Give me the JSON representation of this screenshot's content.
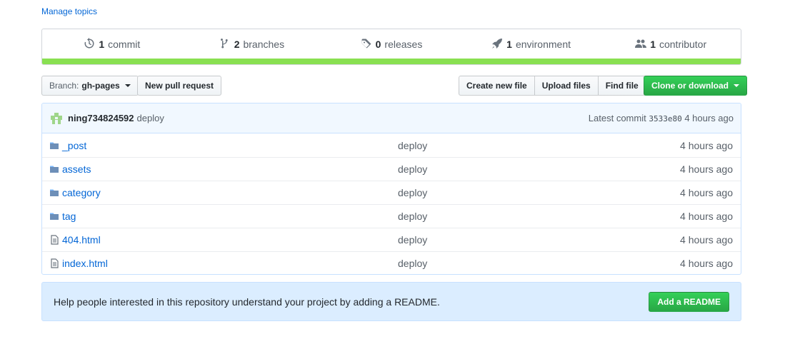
{
  "topics": {
    "manage_label": "Manage topics"
  },
  "summary": {
    "commits": {
      "num": "1",
      "label": "commit",
      "icon": "history-icon"
    },
    "branches": {
      "num": "2",
      "label": "branches",
      "icon": "branch-icon"
    },
    "releases": {
      "num": "0",
      "label": "releases",
      "icon": "tag-icon"
    },
    "environments": {
      "num": "1",
      "label": "environment",
      "icon": "rocket-icon"
    },
    "contributors": {
      "num": "1",
      "label": "contributor",
      "icon": "people-icon"
    },
    "language_color": "#89e051"
  },
  "toolbar": {
    "branch_prefix": "Branch:",
    "branch_name": "gh-pages",
    "new_pr": "New pull request",
    "create_file": "Create new file",
    "upload_files": "Upload files",
    "find_file": "Find file",
    "clone": "Clone or download"
  },
  "commit": {
    "author": "ning734824592",
    "message": "deploy",
    "latest_label": "Latest commit",
    "sha": "3533e80",
    "age": "4 hours ago"
  },
  "files": [
    {
      "name": "_post",
      "type": "dir",
      "message": "deploy",
      "age": "4 hours ago"
    },
    {
      "name": "assets",
      "type": "dir",
      "message": "deploy",
      "age": "4 hours ago"
    },
    {
      "name": "category",
      "type": "dir",
      "message": "deploy",
      "age": "4 hours ago"
    },
    {
      "name": "tag",
      "type": "dir",
      "message": "deploy",
      "age": "4 hours ago"
    },
    {
      "name": "404.html",
      "type": "file",
      "message": "deploy",
      "age": "4 hours ago"
    },
    {
      "name": "index.html",
      "type": "file",
      "message": "deploy",
      "age": "4 hours ago"
    }
  ],
  "readme": {
    "text": "Help people interested in this repository understand your project by adding a README.",
    "button": "Add a README"
  },
  "colors": {
    "link": "#0366d6",
    "primary_green": "#28a745",
    "banner_bg": "#dbedff",
    "commit_bg": "#f1f8ff"
  }
}
